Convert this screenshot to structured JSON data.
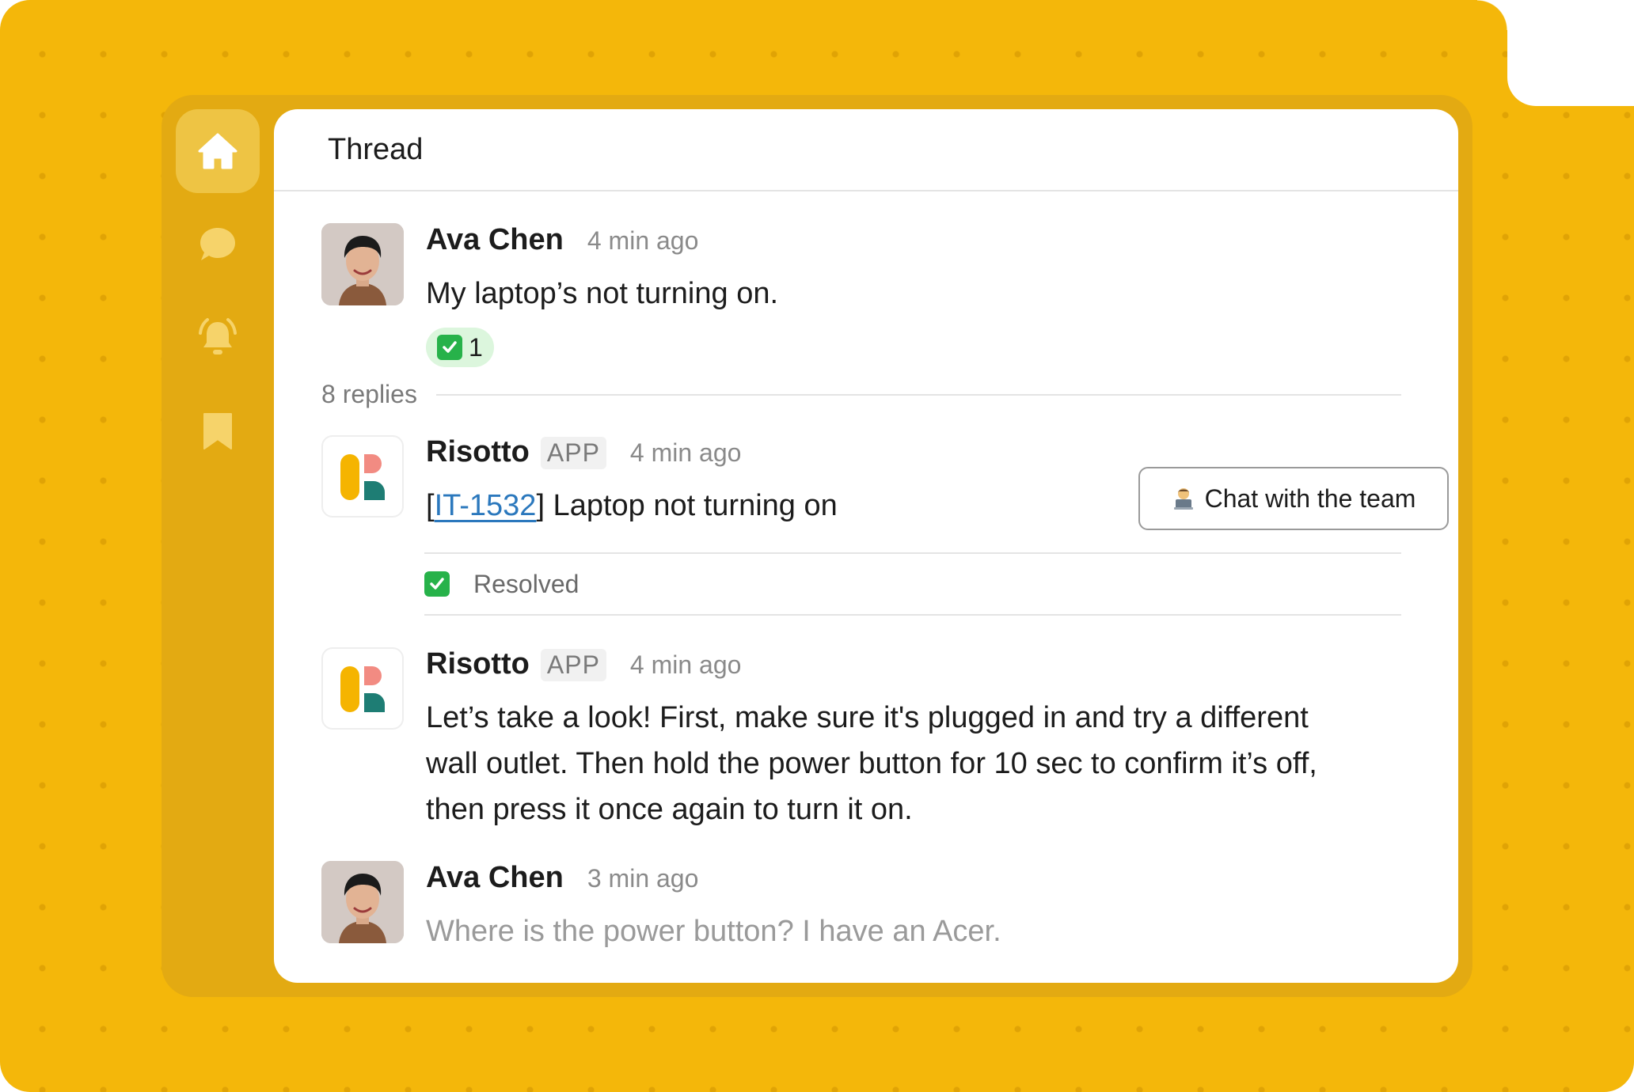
{
  "nav": {
    "items": [
      {
        "icon": "home-icon",
        "active": true
      },
      {
        "icon": "chat-bubble-icon",
        "active": false
      },
      {
        "icon": "alarm-bell-icon",
        "active": false
      },
      {
        "icon": "bookmark-icon",
        "active": false
      }
    ]
  },
  "thread": {
    "title": "Thread",
    "parent": {
      "author": "Ava Chen",
      "time": "4 min ago",
      "text": "My laptop’s not turning on.",
      "reaction": {
        "emoji": "check-mark-button",
        "count": "1"
      }
    },
    "replies_label": "8 replies",
    "replies": [
      {
        "author": "Risotto",
        "badge": "APP",
        "time": "4 min ago",
        "ticket_open": "[",
        "ticket_id": "IT-1532",
        "ticket_close": "]",
        "ticket_title": " Laptop not turning on",
        "button_label": "Chat with the team",
        "status": "Resolved"
      },
      {
        "author": "Risotto",
        "badge": "APP",
        "time": "4 min ago",
        "line1": "Let’s take a look! First, make sure it's plugged in and try a different",
        "line2": "wall outlet. Then hold the power button for 10 sec to confirm it’s off,",
        "line3": "then press it once again to turn it on."
      },
      {
        "author": "Ava Chen",
        "time": "3 min ago",
        "text": "Where is the power button? I have an Acer."
      }
    ]
  },
  "colors": {
    "background": "#f4b70a",
    "sidebar": "#e3aa12",
    "link": "#2b78bd",
    "reaction_bg": "#dcf6dd",
    "check_green": "#27b24a",
    "logo_yellow": "#f5b400",
    "logo_pink": "#f28b82",
    "logo_teal": "#1e7d74"
  }
}
